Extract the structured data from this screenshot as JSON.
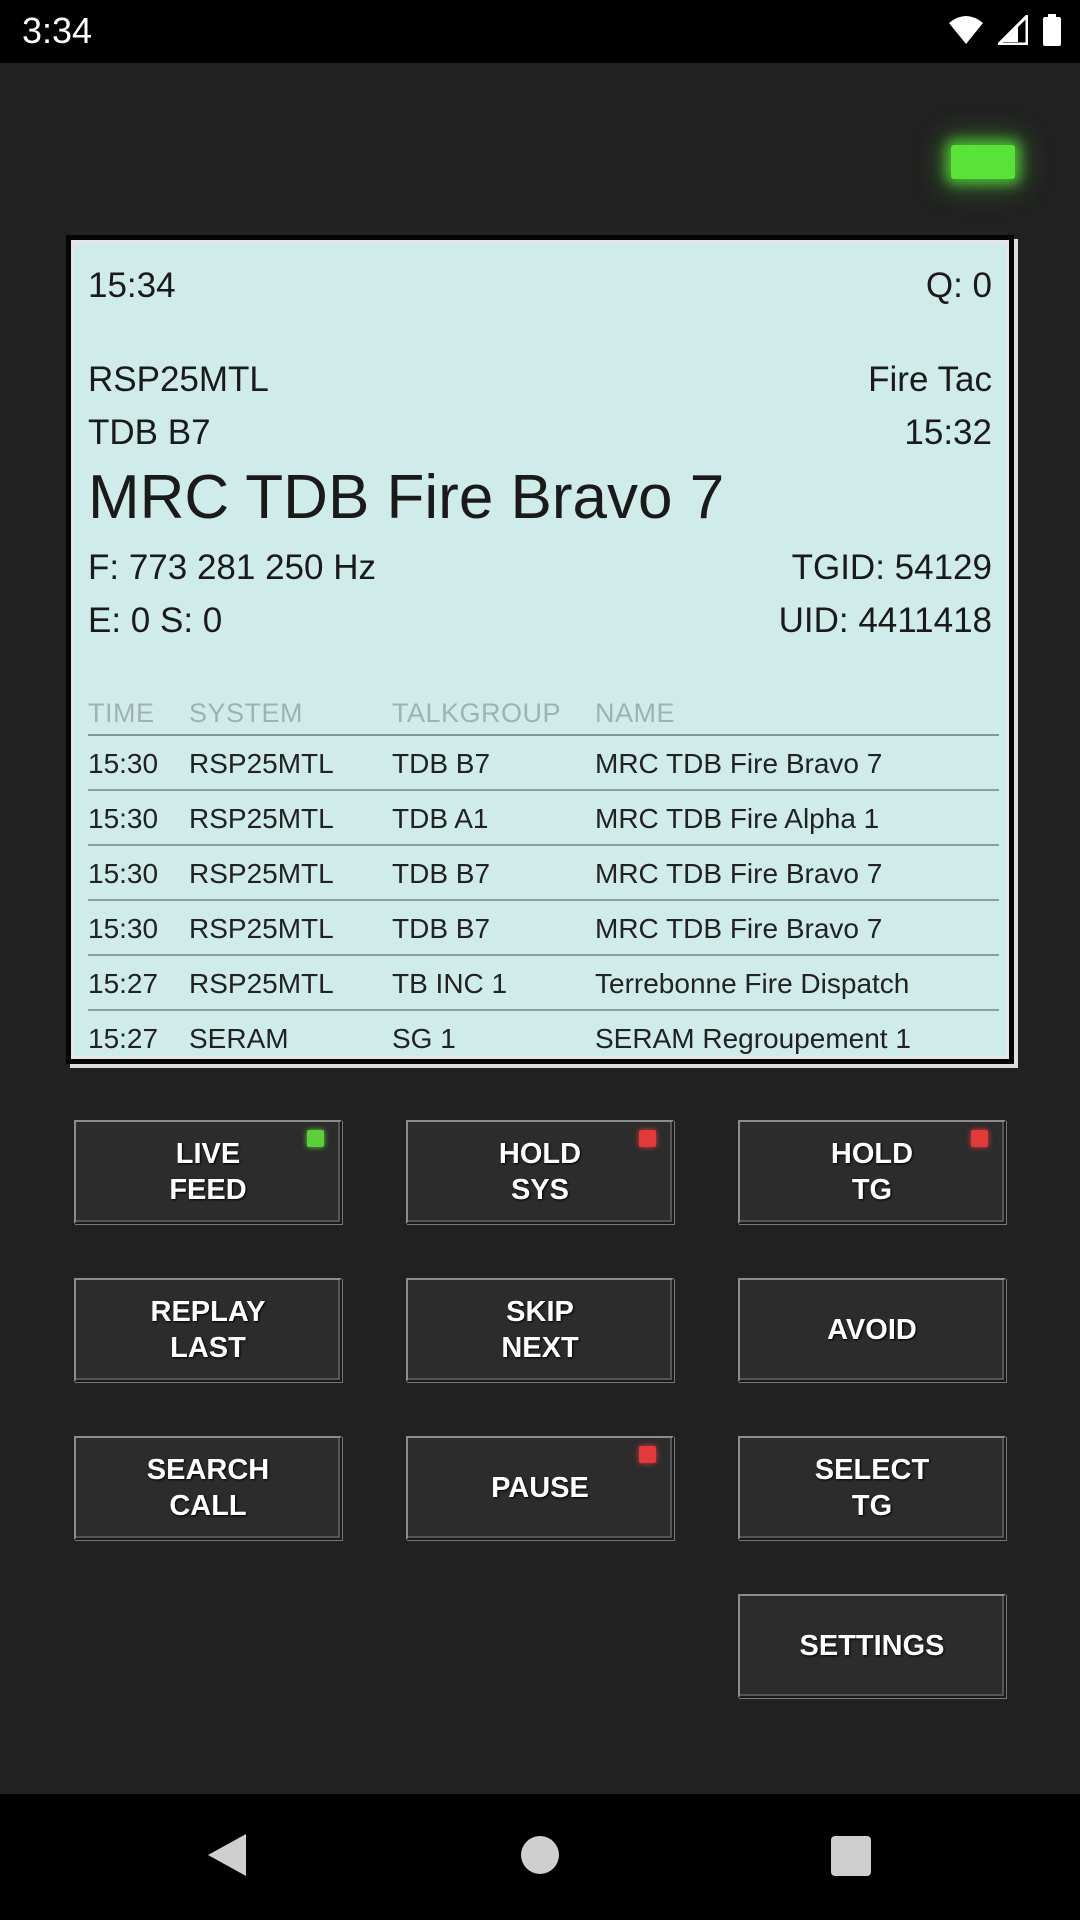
{
  "status_bar": {
    "time": "3:34"
  },
  "colors": {
    "display_bg": "#d0ecea",
    "led_green": "#59e33a",
    "indicator_red": "#e23a3a",
    "indicator_green": "#5ccf3c"
  },
  "display": {
    "clock": "15:34",
    "queue": "Q: 0",
    "system": "RSP25MTL",
    "tag": "Fire Tac",
    "talkgroup": "TDB B7",
    "call_time": "15:32",
    "talkgroup_name": "MRC TDB Fire Bravo 7",
    "frequency": "F: 773 281 250 Hz",
    "tgid": "TGID: 54129",
    "errors_spikes": "E: 0 S: 0",
    "uid": "UID: 4411418",
    "history": {
      "headers": [
        "TIME",
        "SYSTEM",
        "TALKGROUP",
        "NAME"
      ],
      "rows": [
        [
          "15:30",
          "RSP25MTL",
          "TDB B7",
          "MRC TDB Fire Bravo 7"
        ],
        [
          "15:30",
          "RSP25MTL",
          "TDB A1",
          "MRC TDB Fire Alpha 1"
        ],
        [
          "15:30",
          "RSP25MTL",
          "TDB B7",
          "MRC TDB Fire Bravo 7"
        ],
        [
          "15:30",
          "RSP25MTL",
          "TDB B7",
          "MRC TDB Fire Bravo 7"
        ],
        [
          "15:27",
          "RSP25MTL",
          "TB INC 1",
          "Terrebonne Fire Dispatch"
        ],
        [
          "15:27",
          "SERAM",
          "SG 1",
          "SERAM Regroupement 1"
        ]
      ]
    }
  },
  "buttons": {
    "live_feed": "LIVE\nFEED",
    "hold_sys": "HOLD\nSYS",
    "hold_tg": "HOLD\nTG",
    "replay_last": "REPLAY\nLAST",
    "skip_next": "SKIP\nNEXT",
    "avoid": "AVOID",
    "search_call": "SEARCH\nCALL",
    "pause": "PAUSE",
    "select_tg": "SELECT\nTG",
    "settings": "SETTINGS"
  },
  "icons": {
    "status": [
      "wifi-icon",
      "cell-signal-icon",
      "battery-icon"
    ],
    "nav": [
      "back-icon",
      "home-icon",
      "recents-icon"
    ]
  }
}
